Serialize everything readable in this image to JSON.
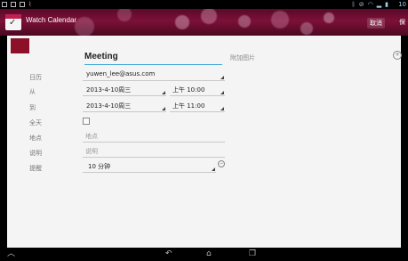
{
  "app": {
    "title": "Watch Calendar",
    "header_buttons": [
      "取消",
      "保"
    ]
  },
  "status": {
    "time": "10",
    "icons": [
      "bluetooth-icon",
      "no-signal-icon",
      "wifi-icon",
      "signal-icon",
      "battery-icon"
    ]
  },
  "event": {
    "title": "Meeting",
    "attach_label": "附加图片",
    "color": "#8b1028",
    "fields": {
      "calendar": {
        "label": "日历",
        "value": "yuwen_lee@asus.com"
      },
      "from": {
        "label": "从",
        "date": "2013-4-10周三",
        "time": "上午 10:00"
      },
      "to": {
        "label": "到",
        "date": "2013-4-10周三",
        "time": "上午 11:00"
      },
      "allday": {
        "label": "全天",
        "checked": false
      },
      "location": {
        "label": "地点",
        "placeholder": "地点"
      },
      "description": {
        "label": "说明",
        "placeholder": "说明"
      },
      "reminder": {
        "label": "提醒",
        "value": "10 分钟"
      }
    }
  },
  "navbar": {
    "icons": [
      "up-arrow-icon",
      "back-icon",
      "home-icon",
      "recent-apps-icon"
    ]
  }
}
